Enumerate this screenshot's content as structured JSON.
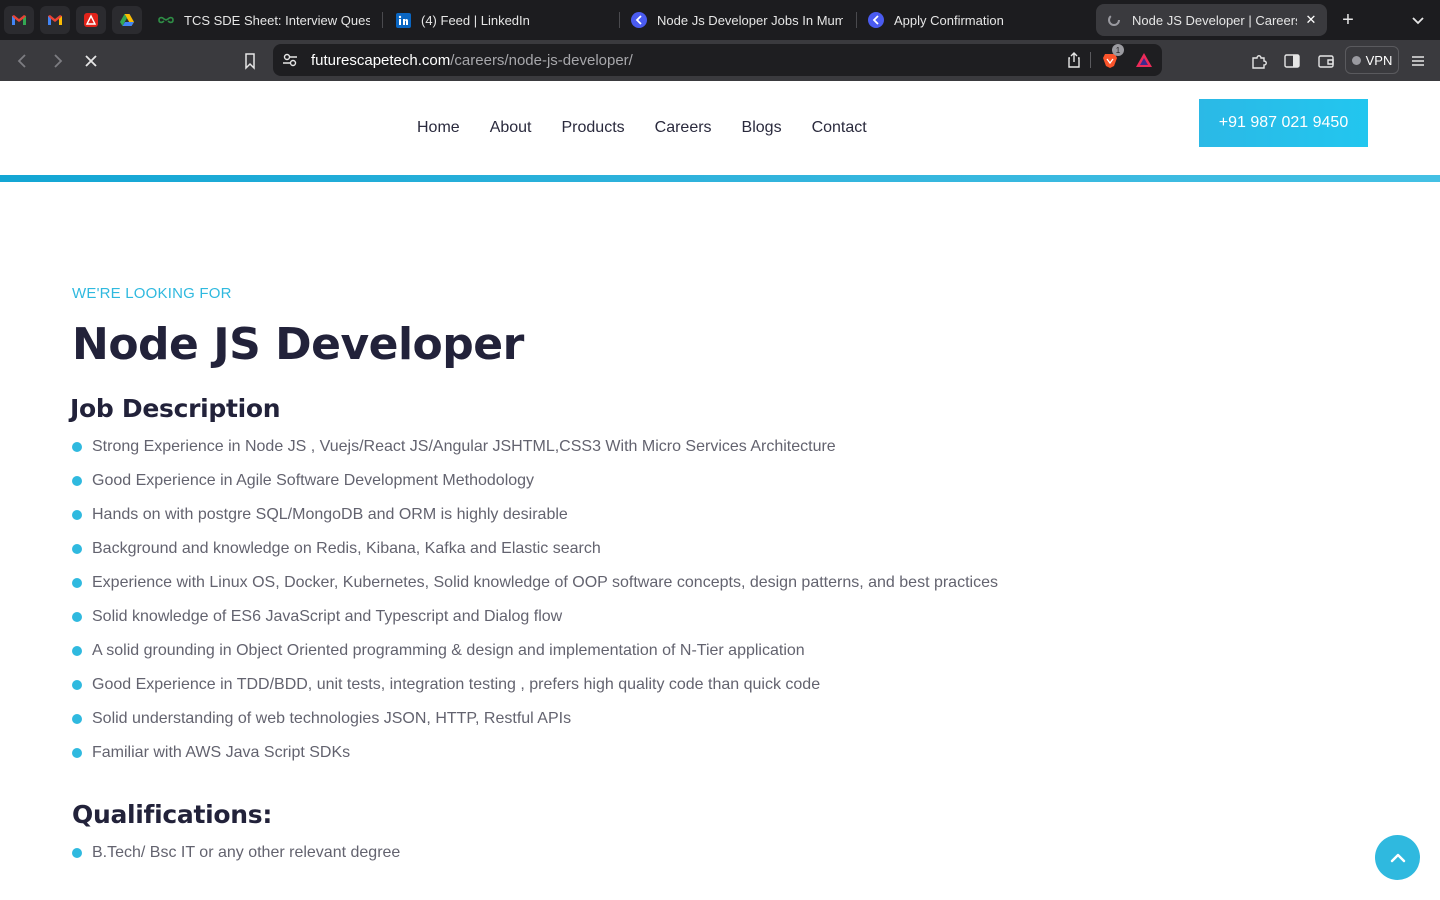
{
  "browser": {
    "tabs": [
      {
        "label": "TCS SDE Sheet: Interview Questio",
        "icon": "gfg-icon"
      },
      {
        "label": "(4) Feed | LinkedIn",
        "icon": "linkedin-icon"
      },
      {
        "label": "Node Js Developer Jobs In Mumb",
        "icon": "job-site-icon"
      },
      {
        "label": "Apply Confirmation",
        "icon": "job-site-icon"
      },
      {
        "label": "Node JS Developer | Careers",
        "icon": "loading-icon",
        "active": true
      }
    ],
    "pinned_tabs": [
      "gmail-icon",
      "gmail-icon",
      "acrobat-icon",
      "google-drive-icon"
    ],
    "url_host": "futurescapetech.com",
    "url_path": "/careers/node-js-developer/",
    "shields_count": "1",
    "vpn_label": "VPN"
  },
  "site": {
    "nav": [
      "Home",
      "About",
      "Products",
      "Careers",
      "Blogs",
      "Contact"
    ],
    "phone": "+91 987 021 9450"
  },
  "content": {
    "eyebrow": "WE'RE LOOKING FOR",
    "title": "Node JS Developer",
    "job_description_heading": "Job Description",
    "job_description": [
      "Strong Experience in Node JS , Vuejs/React JS/Angular JSHTML,CSS3 With Micro Services Architecture",
      "Good Experience in Agile Software Development Methodology",
      "Hands on with postgre SQL/MongoDB and ORM is highly desirable",
      "Background and knowledge on Redis, Kibana, Kafka and Elastic search",
      "Experience with Linux OS, Docker, Kubernetes, Solid knowledge of OOP software concepts, design patterns, and best practices",
      "Solid knowledge of ES6 JavaScript and Typescript and Dialog flow",
      "A solid grounding in Object Oriented programming & design and implementation of N-Tier application",
      "Good Experience in TDD/BDD, unit tests, integration testing , prefers high quality code than quick code",
      "Solid understanding of web technologies JSON, HTTP, Restful APIs",
      "Familiar with AWS Java Script SDKs"
    ],
    "qualifications_heading": "Qualifications:",
    "qualifications": [
      "B.Tech/ Bsc IT or any other relevant degree"
    ]
  },
  "colors": {
    "accent": "#2fb9df",
    "heading": "#22223a",
    "body_text": "#63636f"
  }
}
